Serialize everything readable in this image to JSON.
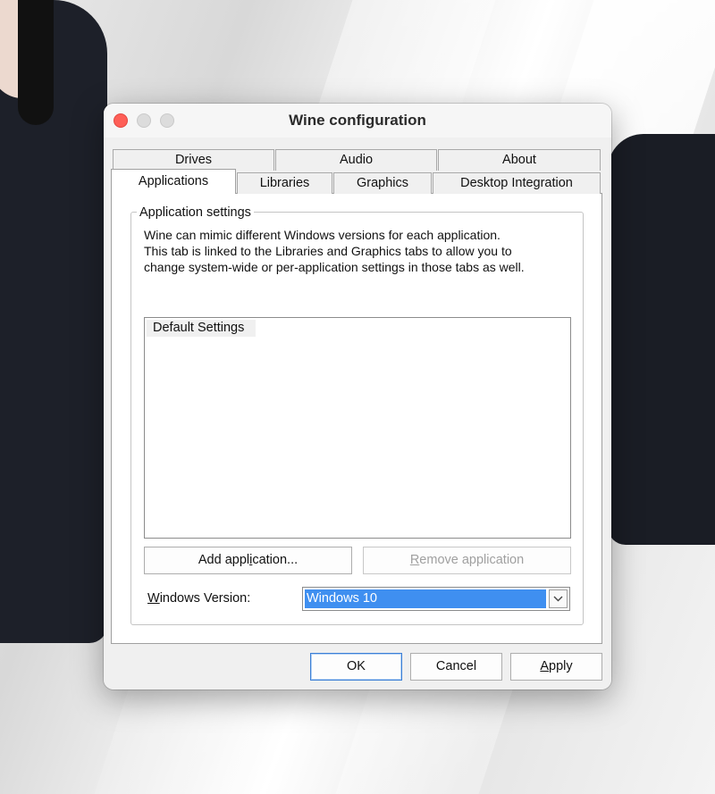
{
  "window": {
    "title": "Wine configuration"
  },
  "tabs": {
    "row1": [
      {
        "label": "Drives"
      },
      {
        "label": "Audio"
      },
      {
        "label": "About"
      }
    ],
    "row2": [
      {
        "label": "Applications",
        "selected": true
      },
      {
        "label": "Libraries"
      },
      {
        "label": "Graphics"
      },
      {
        "label": "Desktop Integration"
      }
    ]
  },
  "app_settings": {
    "group_label": "Application settings",
    "description_lines": [
      "Wine can mimic different Windows versions for each application.",
      "This tab is linked to the Libraries and Graphics tabs to allow you to",
      "change system-wide or per-application settings in those tabs as well."
    ],
    "list_items": [
      "Default Settings"
    ],
    "add_button": {
      "before": "Add appl",
      "accel": "i",
      "after": "cation..."
    },
    "remove_button": {
      "accel": "R",
      "after": "emove application"
    },
    "windows_version": {
      "label_accel": "W",
      "label_rest": "indows Version:",
      "selected": "Windows 10"
    }
  },
  "footer": {
    "ok": "OK",
    "cancel": "Cancel",
    "apply": {
      "accel": "A",
      "after": "pply"
    }
  },
  "colors": {
    "close": "#fe5f57",
    "selection": "#3f8ff0",
    "default_button_border": "#3c7fd6"
  }
}
